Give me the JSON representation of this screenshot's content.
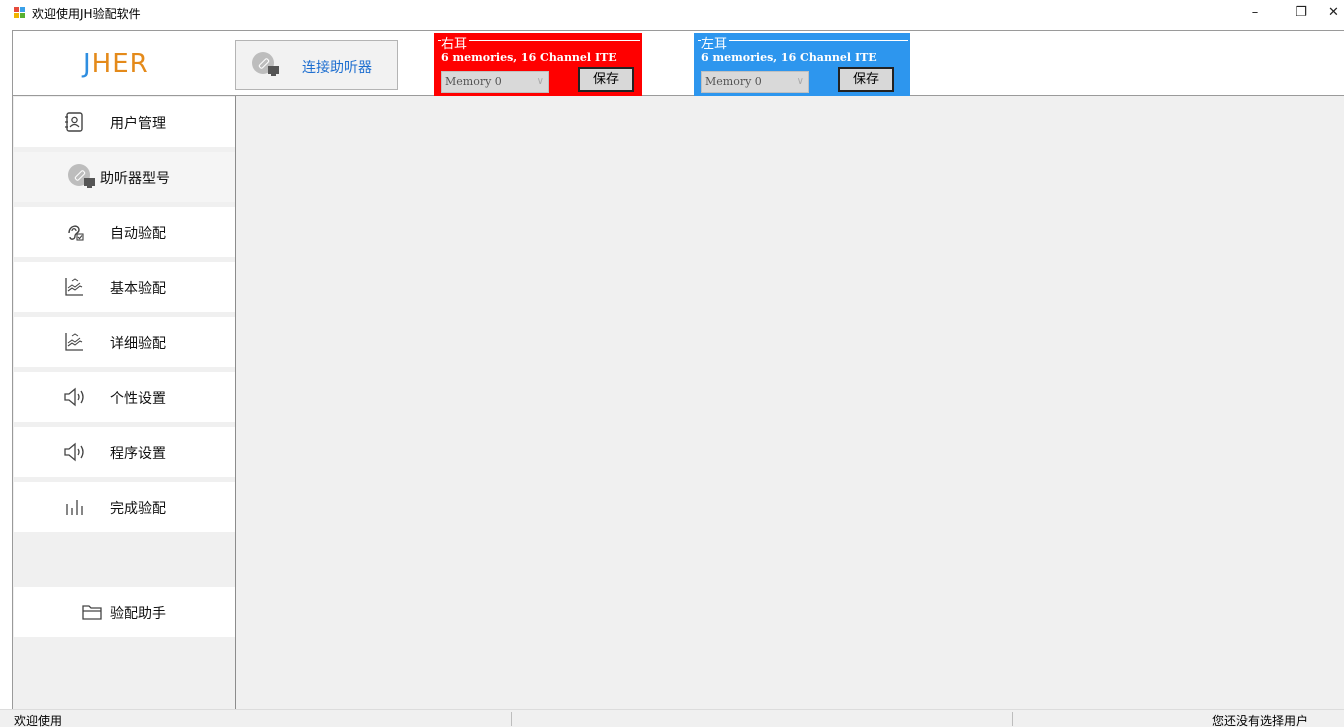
{
  "window": {
    "title": "欢迎使用JH验配软件",
    "controls": {
      "minimize": "–",
      "restore": "❐",
      "close": "✕"
    }
  },
  "header": {
    "logo": {
      "j": "J",
      "h": "H",
      "e": "E",
      "r": "R"
    },
    "connect_label": "连接助听器",
    "right_ear": {
      "title": "右耳",
      "description": "6 memories, 16 Channel ITE",
      "memory_select": "Memory 0",
      "save_label": "保存",
      "color": "#ff0000"
    },
    "left_ear": {
      "title": "左耳",
      "description": "6 memories, 16 Channel ITE",
      "memory_select": "Memory 0",
      "save_label": "保存",
      "color": "#2d96ee"
    }
  },
  "sidebar": {
    "items": [
      {
        "label": "用户管理",
        "icon": "contact-book-icon"
      },
      {
        "label": "助听器型号",
        "icon": "hearing-aid-device-icon"
      },
      {
        "label": "自动验配",
        "icon": "ear-check-icon"
      },
      {
        "label": "基本验配",
        "icon": "chart-wave-icon"
      },
      {
        "label": "详细验配",
        "icon": "chart-wave-icon"
      },
      {
        "label": "个性设置",
        "icon": "speaker-icon"
      },
      {
        "label": "程序设置",
        "icon": "speaker-icon"
      },
      {
        "label": "完成验配",
        "icon": "bars-icon"
      }
    ],
    "assistant_label": "验配助手",
    "assistant_icon": "folder-icon"
  },
  "status": {
    "left": "欢迎使用",
    "right": "您还没有选择用户"
  }
}
